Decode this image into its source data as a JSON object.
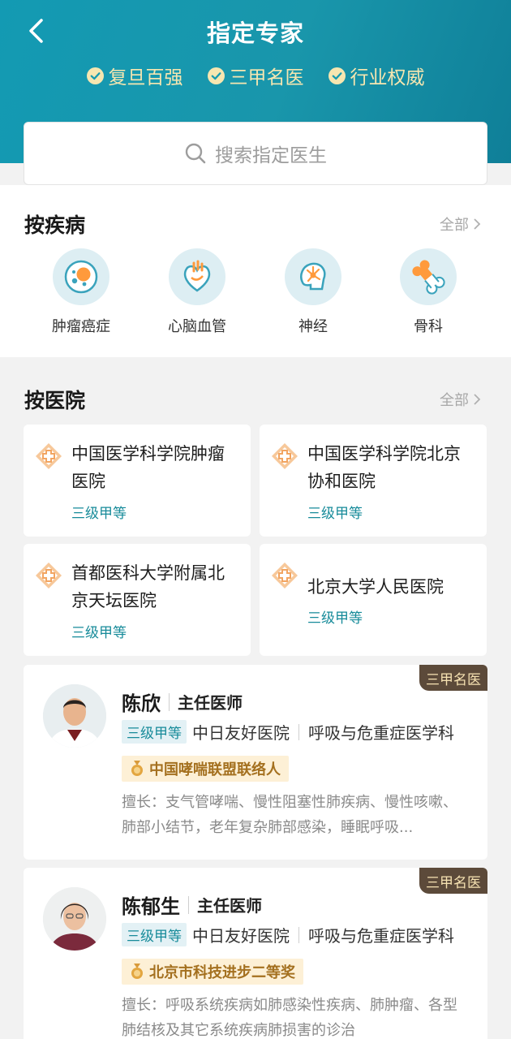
{
  "header": {
    "title": "指定专家",
    "badges": [
      "复旦百强",
      "三甲名医",
      "行业权威"
    ]
  },
  "search": {
    "placeholder": "搜索指定医生"
  },
  "diseases": {
    "title": "按疾病",
    "more": "全部",
    "items": [
      {
        "label": "肿瘤癌症",
        "icon": "tumor-cell-icon"
      },
      {
        "label": "心脑血管",
        "icon": "heart-icon"
      },
      {
        "label": "神经",
        "icon": "brain-neuron-icon"
      },
      {
        "label": "骨科",
        "icon": "bone-icon"
      }
    ]
  },
  "hospitals": {
    "title": "按医院",
    "more": "全部",
    "items": [
      {
        "name": "中国医学科学院肿瘤医院",
        "level": "三级甲等"
      },
      {
        "name": "中国医学科学院北京协和医院",
        "level": "三级甲等"
      },
      {
        "name": "首都医科大学附属北京天坛医院",
        "level": "三级甲等"
      },
      {
        "name": "北京大学人民医院",
        "level": "三级甲等"
      }
    ]
  },
  "doctors": [
    {
      "tag": "三甲名医",
      "name": "陈欣",
      "title": "主任医师",
      "level": "三级甲等",
      "hospital": "中日友好医院",
      "department": "呼吸与危重症医学科",
      "award": "中国哮喘联盟联络人",
      "skill": "擅长：支气管哮喘、慢性阻塞性肺疾病、慢性咳嗽、肺部小结节，老年复杂肺部感染，睡眠呼吸..."
    },
    {
      "tag": "三甲名医",
      "name": "陈郁生",
      "title": "主任医师",
      "level": "三级甲等",
      "hospital": "中日友好医院",
      "department": "呼吸与危重症医学科",
      "award": "北京市科技进步二等奖",
      "skill": "擅长：呼吸系统疾病如肺感染性疾病、肺肿瘤、各型肺结核及其它系统疾病肺损害的诊治"
    }
  ],
  "colors": {
    "header_bg": "#1996ab",
    "accent_teal": "#178b9a",
    "badge_gold": "#f6e6b0",
    "tag_brown": "#5c4a3a",
    "award_bg": "#fdf0d6"
  }
}
